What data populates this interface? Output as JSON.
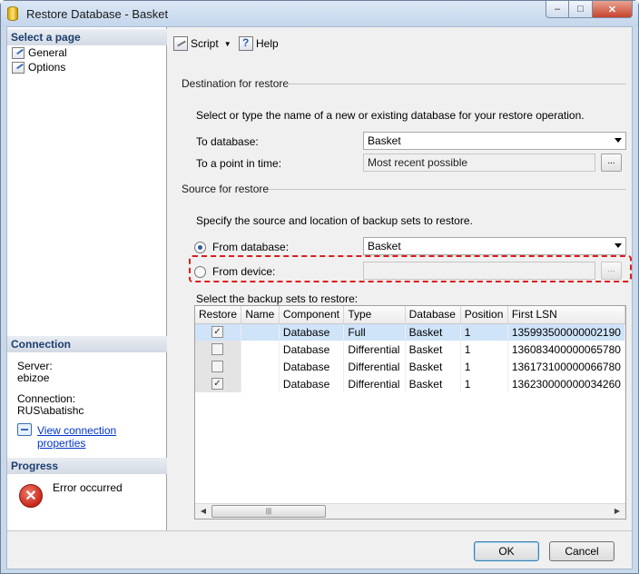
{
  "window": {
    "title": "Restore Database - Basket",
    "controls": {
      "minimize": "–",
      "maximize": "□",
      "close": "✕"
    }
  },
  "sidebar": {
    "header": "Select a page",
    "pages": [
      {
        "label": "General",
        "icon": "page-wrench-icon"
      },
      {
        "label": "Options",
        "icon": "page-wrench-icon"
      }
    ],
    "connection": {
      "header": "Connection",
      "server_label": "Server:",
      "server_value": "ebizoe",
      "connection_label": "Connection:",
      "connection_value": "RUS\\abatishc",
      "link": "View connection properties"
    },
    "progress": {
      "header": "Progress",
      "status": "Error occurred"
    }
  },
  "toolbar": {
    "script": "Script",
    "help": "Help"
  },
  "destination": {
    "section": "Destination for restore",
    "description": "Select or type the name of a new or existing database for your restore operation.",
    "to_database_label": "To database:",
    "to_database_value": "Basket",
    "point_in_time_label": "To a point in time:",
    "point_in_time_value": "Most recent possible",
    "browse": "..."
  },
  "source": {
    "section": "Source for restore",
    "description": "Specify the source and location of backup sets to restore.",
    "from_database_label": "From database:",
    "from_database_value": "Basket",
    "from_device_label": "From device:",
    "from_device_value": "",
    "browse": "...",
    "selected_option": "From database"
  },
  "backup_sets": {
    "label": "Select the backup sets to restore:",
    "columns": [
      "Restore",
      "Name",
      "Component",
      "Type",
      "Database",
      "Position",
      "First LSN"
    ],
    "rows": [
      {
        "restore": true,
        "name": "",
        "component": "Database",
        "type": "Full",
        "database": "Basket",
        "position": "1",
        "first_lsn": "135993500000002190"
      },
      {
        "restore": false,
        "name": "",
        "component": "Database",
        "type": "Differential",
        "database": "Basket",
        "position": "1",
        "first_lsn": "136083400000065780"
      },
      {
        "restore": false,
        "name": "",
        "component": "Database",
        "type": "Differential",
        "database": "Basket",
        "position": "1",
        "first_lsn": "136173100000066780"
      },
      {
        "restore": true,
        "name": "",
        "component": "Database",
        "type": "Differential",
        "database": "Basket",
        "position": "1",
        "first_lsn": "136230000000034260"
      }
    ]
  },
  "buttons": {
    "ok": "OK",
    "cancel": "Cancel"
  },
  "colors": {
    "title_bar": "#c9d9ec",
    "close_button": "#c7432b",
    "highlight": "#dd1c1c",
    "selected_row": "#cfe3f9"
  }
}
